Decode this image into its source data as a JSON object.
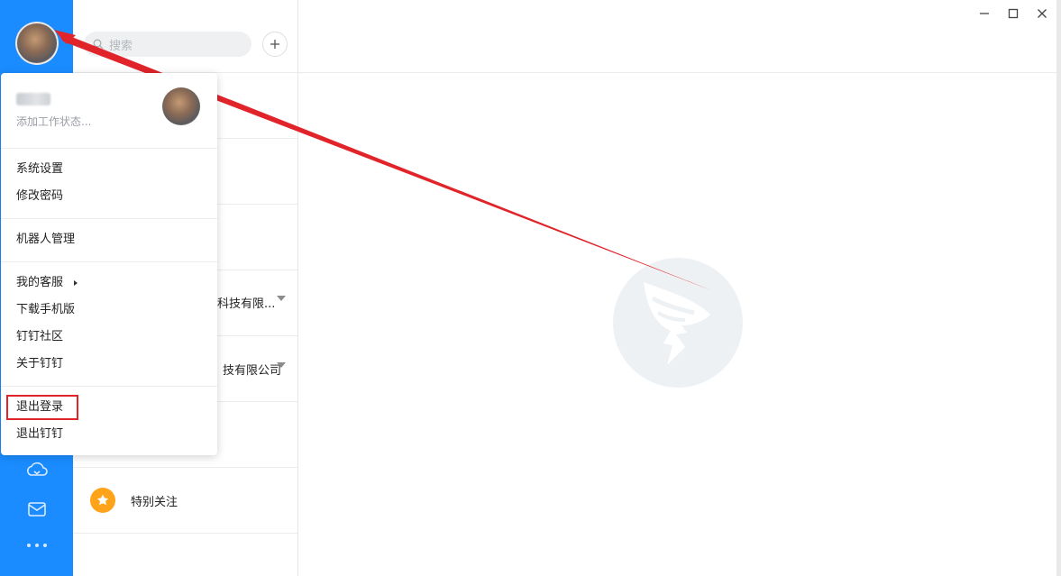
{
  "search": {
    "placeholder": "搜索"
  },
  "conversations": {
    "item_4_text": "科技有限...",
    "item_5_text": "技有限公司",
    "special_label": "特别关注"
  },
  "profile_menu": {
    "status_placeholder": "添加工作状态...",
    "items": [
      {
        "label": "系统设置"
      },
      {
        "label": "修改密码"
      },
      {
        "label": "机器人管理"
      },
      {
        "label": "我的客服"
      },
      {
        "label": "下载手机版"
      },
      {
        "label": "钉钉社区"
      },
      {
        "label": "关于钉钉"
      },
      {
        "label": "退出登录"
      },
      {
        "label": "退出钉钉"
      }
    ]
  },
  "icons": {
    "rail": [
      "avatar",
      "cloud-drive-icon",
      "mail-icon",
      "more-icon"
    ],
    "window": [
      "minimize-icon",
      "maximize-icon",
      "close-icon"
    ],
    "brand": "dingtalk-logo"
  },
  "colors": {
    "rail_blue": "#1a8cff",
    "annotation_red": "#e0242a",
    "star_orange": "#ffa31a"
  }
}
